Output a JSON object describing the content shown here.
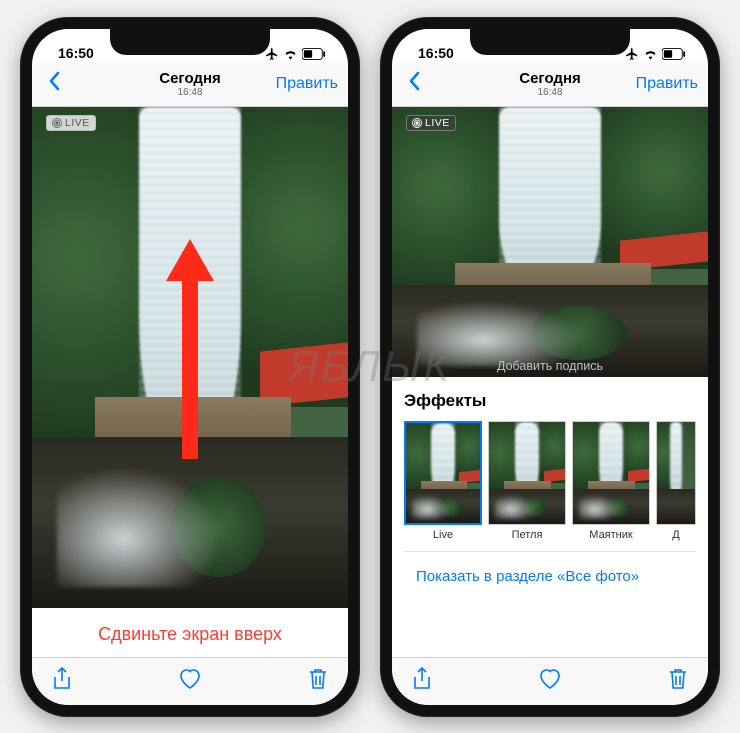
{
  "statusbar": {
    "time": "16:50"
  },
  "navbar": {
    "title": "Сегодня",
    "subtitle": "16:48",
    "edit": "Править"
  },
  "live_badge": "LIVE",
  "hint": "Сдвиньте экран вверх",
  "caption_placeholder": "Добавить подпись",
  "effects": {
    "title": "Эффекты",
    "items": [
      {
        "label": "Live",
        "selected": true
      },
      {
        "label": "Петля",
        "selected": false
      },
      {
        "label": "Маятник",
        "selected": false
      },
      {
        "label": "Д",
        "selected": false
      }
    ]
  },
  "show_all_link": "Показать в разделе «Все фото»",
  "watermark": "ЯБЛЫК",
  "icons": {
    "back": "chevron-left",
    "share": "share",
    "heart": "heart",
    "trash": "trash",
    "airplane": "airplane-mode",
    "wifi": "wifi",
    "battery": "battery"
  },
  "colors": {
    "tint": "#007aff",
    "danger": "#ff3b30",
    "roof": "#c23b2a"
  }
}
